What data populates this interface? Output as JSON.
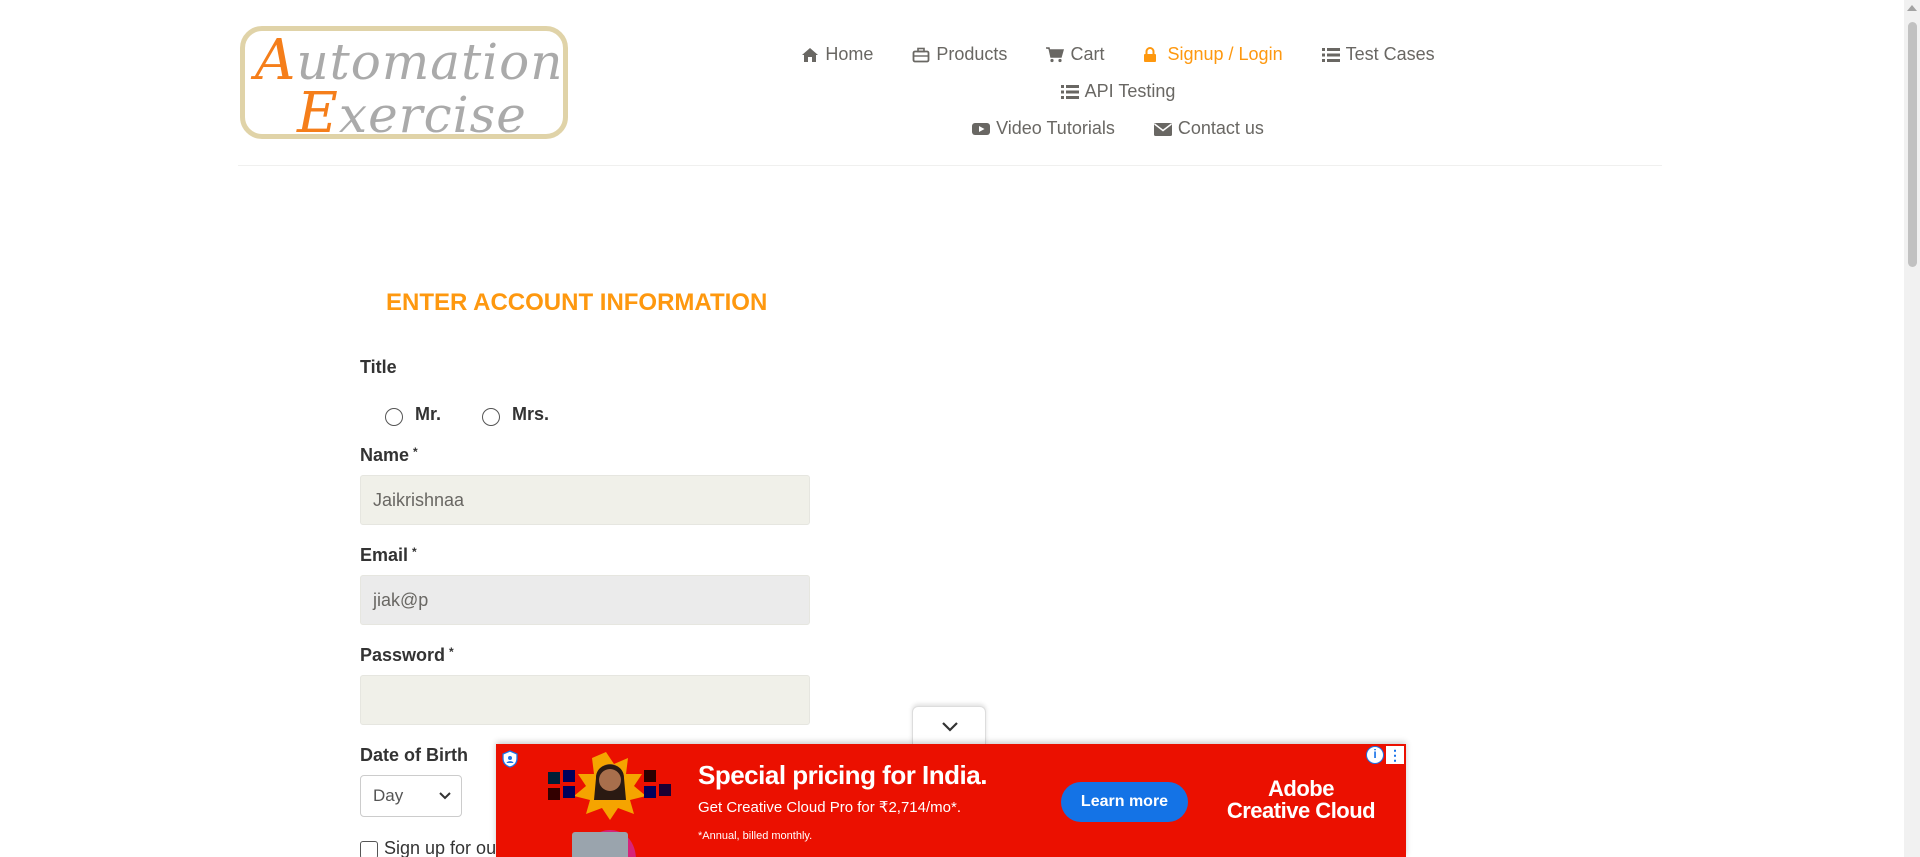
{
  "logo": {
    "line1_cap": "A",
    "line1_rest": "utomation",
    "line2_cap": "E",
    "line2_rest": "xercise"
  },
  "nav": {
    "home": "Home",
    "products": "Products",
    "cart": "Cart",
    "signup_login": "Signup / Login",
    "test_cases": "Test Cases",
    "api_testing": "API Testing",
    "video_tutorials": "Video Tutorials",
    "contact_us": "Contact us"
  },
  "colors": {
    "accent": "#fe980f",
    "nav_text": "#696763",
    "ad_red": "#eb1000",
    "ad_button": "#1473e6"
  },
  "form": {
    "heading": "ENTER ACCOUNT INFORMATION",
    "title_label": "Title",
    "title_options": [
      "Mr.",
      "Mrs."
    ],
    "name_label": "Name",
    "name_value": "Jaikrishnaa",
    "email_label": "Email",
    "email_value": "jiak@p",
    "password_label": "Password",
    "password_value": "",
    "required_mark": "*",
    "dob_label": "Date of Birth",
    "dob_day": "Day",
    "newsletter_label": "Sign up for ou"
  },
  "ad": {
    "headline": "Special pricing for India.",
    "subline": "Get Creative Cloud Pro for ₹2,714/mo*.",
    "fine_print": "*Annual, billed monthly.",
    "cta": "Learn more",
    "brand_line1": "Adobe",
    "brand_line2": "Creative Cloud",
    "info_icon": "i",
    "more_icon": "⋮"
  }
}
